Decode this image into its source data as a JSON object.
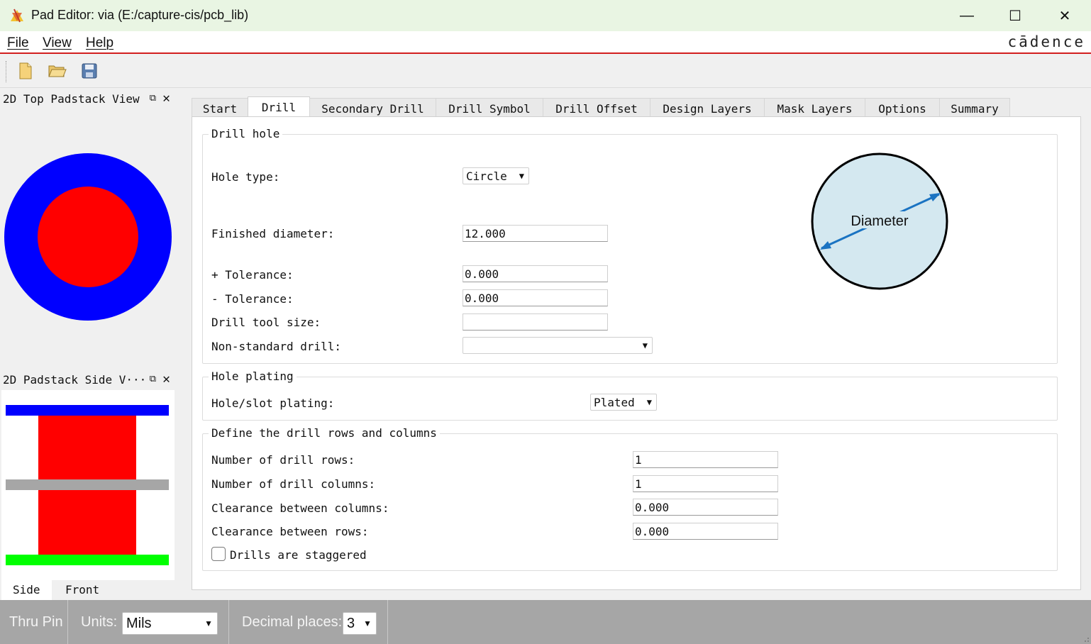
{
  "window": {
    "title": "Pad Editor: via  (E:/capture-cis/pcb_lib)",
    "minimize_label": "—",
    "maximize_label": "☐",
    "close_label": "✕"
  },
  "menu": {
    "file": "File",
    "view": "View",
    "help": "Help",
    "brand": "cādence"
  },
  "toolbar": {
    "icons": [
      "new-file-icon",
      "open-folder-icon",
      "save-icon"
    ]
  },
  "top_view": {
    "title": "2D Top Padstack View",
    "float_glyph": "⧉",
    "close_glyph": "✕",
    "outer_color": "#0000ff",
    "inner_color": "#ff0000"
  },
  "side_view": {
    "title": "2D Padstack Side V···",
    "float_glyph": "⧉",
    "close_glyph": "✕",
    "tabs": [
      "Side",
      "Front"
    ],
    "top_layer_color": "#0000ff",
    "drill_color": "#ff0000",
    "inner_layer_color": "#a6a6a6",
    "bottom_layer_color": "#00ff00"
  },
  "tabs": [
    "Start",
    "Drill",
    "Secondary Drill",
    "Drill Symbol",
    "Drill Offset",
    "Design Layers",
    "Mask Layers",
    "Options",
    "Summary"
  ],
  "active_tab": "Drill",
  "drill_hole": {
    "title": "Drill hole",
    "hole_type_label": "Hole type:",
    "hole_type_value": "Circle",
    "finished_diameter_label": "Finished diameter:",
    "finished_diameter_value": "12.000",
    "plus_tol_label": "+ Tolerance:",
    "plus_tol_value": "0.000",
    "minus_tol_label": "- Tolerance:",
    "minus_tol_value": "0.000",
    "tool_size_label": "Drill tool size:",
    "tool_size_value": "",
    "nonstd_label": "Non-standard drill:",
    "nonstd_value": "",
    "diagram_label": "Diameter"
  },
  "hole_plating": {
    "title": "Hole plating",
    "label": "Hole/slot plating:",
    "value": "Plated"
  },
  "rows_cols": {
    "title": "Define the drill rows and columns",
    "rows_label": "Number of drill rows:",
    "rows_value": "1",
    "cols_label": "Number of drill columns:",
    "cols_value": "1",
    "clear_cols_label": "Clearance between columns:",
    "clear_cols_value": "0.000",
    "clear_rows_label": "Clearance between rows:",
    "clear_rows_value": "0.000",
    "staggered_label": "Drills are staggered",
    "staggered_checked": false
  },
  "status": {
    "mode": "Thru Pin",
    "units_label": "Units:",
    "units_value": "Mils",
    "decimal_label": "Decimal places:",
    "decimal_value": "3"
  }
}
